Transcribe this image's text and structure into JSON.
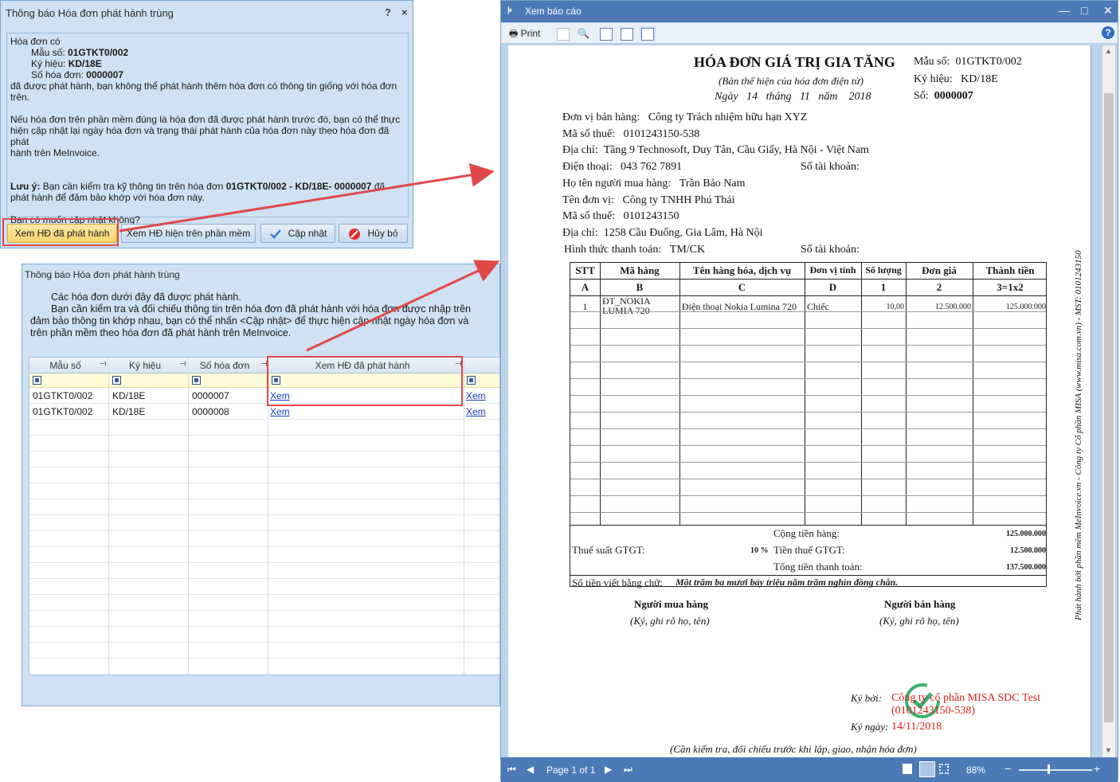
{
  "dialog1": {
    "title": "Thông báo Hóa đơn phát hành trùng",
    "help": "?",
    "close": "×",
    "intro": "Hóa đơn có",
    "template_label": "Mẫu số:",
    "template_value": "01GTKT0/002",
    "symbol_label": "Ký hiệu:",
    "symbol_value": "KD/18E",
    "number_label": "Số hóa đơn:",
    "number_value": "0000007",
    "line_issued_1": "đã được phát hành, bạn không thể phát hành thêm hóa đơn có thông tin giống với hóa đơn",
    "line_issued_2": "trên.",
    "line_software_1": "Nếu hóa đơn trên phần mềm đúng là hóa đơn đã được phát hành trước đó, bạn có thể thực",
    "line_software_2": "hiện cập nhật lại ngày hóa đơn và trạng thái phát hành của hóa đơn này theo hóa đơn đã phát",
    "line_software_3": "hành trên MeInvoice.",
    "note_label": "Lưu ý:",
    "note_text_1": " Bạn cần kiểm tra kỹ thông tin trên hóa đơn ",
    "note_bold": "01GTKT0/002 - KD/18E- 0000007",
    "note_text_2": " đã",
    "note_line_2": "phát hành để đảm bảo khớp với hóa đơn này.",
    "question": "Bạn có muốn cập nhật không?",
    "buttons": {
      "view_issued": "Xem HĐ đã phát hành",
      "view_software": "Xem HĐ hiện trên phần mềm",
      "update": "Cập nhật",
      "cancel": "Hủy bỏ"
    }
  },
  "dialog2": {
    "title": "Thông báo Hóa đơn phát hành trùng",
    "line1": "Các hóa đơn dưới đây đã được phát hành.",
    "line2": "Bạn cần kiểm tra và đối chiếu thông tin trên hóa đơn đã phát hành với hóa đơn được nhập trên",
    "line3": "đảm bảo thông tin khớp nhau, bạn có thể nhấn <Cập nhật> để thực hiện cập nhật ngày hóa đơn và",
    "line4": "trên phần mềm theo hóa đơn đã phát hành trên MeInvoice.",
    "columns": [
      "Mẫu số",
      "Ký hiệu",
      "Số hóa đơn",
      "Xem HĐ đã phát hành"
    ],
    "rows": [
      {
        "template": "01GTKT0/002",
        "symbol": "KD/18E",
        "number": "0000007",
        "view": "Xem",
        "view2": "Xem"
      },
      {
        "template": "01GTKT0/002",
        "symbol": "KD/18E",
        "number": "0000008",
        "view": "Xem",
        "view2": "Xem"
      }
    ]
  },
  "viewer": {
    "title": "Xem báo cáo",
    "print": "Print",
    "page_label": "Page 1 of 1",
    "zoom": "88%",
    "invoice": {
      "title": "HÓA ĐƠN GIÁ TRỊ GIA TĂNG",
      "subtitle": "(Bản thể hiện của hóa đơn điện tử)",
      "date_day_label": "Ngày",
      "day": "14",
      "month_label": "tháng",
      "month": "11",
      "year_label": "năm",
      "year": "2018",
      "template_label": "Mẫu số:",
      "template": "01GTKT0/002",
      "symbol_label": "Ký hiệu:",
      "symbol": "KD/18E",
      "number_label": "Số:",
      "number": "0000007",
      "seller_label": "Đơn vị bán hàng:",
      "seller": "Công ty Trách nhiệm hữu hạn XYZ",
      "seller_tax_label": "Mã số thuế:",
      "seller_tax": "0101243150-538",
      "seller_addr_label": "Địa chỉ:",
      "seller_addr": "Tầng 9 Technosoft, Duy Tân, Cầu Giấy, Hà Nội - Việt Nam",
      "seller_phone_label": "Điện thoại:",
      "seller_phone": "043 762 7891",
      "account_label": "Số tài khoản:",
      "buyer_name_label": "Họ tên người mua hàng:",
      "buyer_name": "Trần Bảo Nam",
      "buyer_unit_label": "Tên đơn vị:",
      "buyer_unit": "Công ty TNHH Phú Thái",
      "buyer_tax_label": "Mã số thuế:",
      "buyer_tax": "0101243150",
      "buyer_addr_label": "Địa chỉ:",
      "buyer_addr": "1258 Cầu Đuống, Gia Lâm, Hà Nội",
      "payment_label": "Hình thức thanh toán:",
      "payment": "TM/CK",
      "buyer_account_label": "Số tài khoản:",
      "table_headers": [
        "STT",
        "Mã hàng",
        "Tên hàng hóa, dịch vụ",
        "Đơn vị tính",
        "Số lượng",
        "Đơn giá",
        "Thành tiền"
      ],
      "table_codes": [
        "A",
        "B",
        "C",
        "D",
        "1",
        "2",
        "3=1x2"
      ],
      "items": [
        {
          "stt": "1",
          "code_1": "ĐT_NOKIA",
          "code_2": "LUMIA 720",
          "name": "Điện thoại Nokia Lumina 720",
          "unit": "Chiếc",
          "qty": "10,00",
          "price": "12.500.000",
          "amount": "125.000.000"
        }
      ],
      "subtotal_label": "Cộng tiền hàng:",
      "subtotal": "125.000.000",
      "vat_rate_label": "Thuế suất GTGT:",
      "vat_rate": "10 %",
      "vat_amount_label": "Tiền thuế GTGT:",
      "vat_amount": "12.500.000",
      "total_label": "Tổng tiền thanh toán:",
      "total": "137.500.000",
      "words_label": "Số tiền viết bằng chữ:",
      "words": "Một trăm ba mươi bảy triệu năm trăm nghìn đồng chẵn.",
      "buyer_sign": "Người mua hàng",
      "seller_sign": "Người bán hàng",
      "sign_note": "(Ký, ghi rõ họ, tên)",
      "signed_by_label": "Ký bởi:",
      "signed_by": "Công ty cổ phần MISA SDC Test",
      "signed_tax": "(0101243150-538)",
      "signed_date_label": "Ký ngày:",
      "signed_date": "14/11/2018",
      "footer_note": "(Cần kiểm tra, đối chiếu trước khi lập, giao, nhận hóa đơn)",
      "side_text": "Phát hành bởi phần mềm MeInvoice.vn - Công ty Cổ phần MISA (www.misa.com.vn) - MST: 0101243150"
    }
  },
  "colors": {
    "highlight_red": "#e04848",
    "dialog_bg": "#cfe1f3",
    "viewer_bar": "#4b7ab6",
    "signature_red": "#d42020"
  }
}
